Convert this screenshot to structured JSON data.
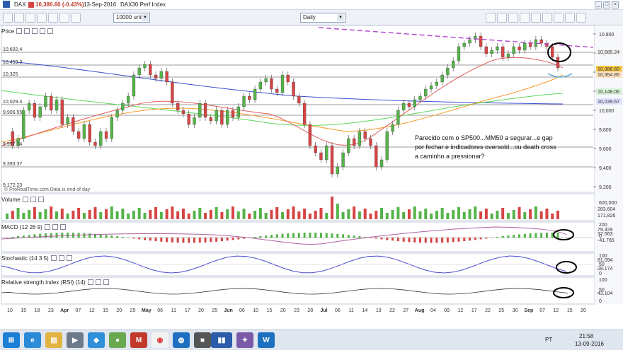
{
  "titlebar": {
    "symbol": "DAX",
    "price": "10,386.60 (-0.43%)",
    "date": "13-Sep-2016",
    "instrument": "DAX30 Perf Index"
  },
  "toolbar": {
    "units": "10000 units",
    "period": "Daily"
  },
  "panels": {
    "price": "Price",
    "volume": "Volume",
    "macd": "MACD (12 26 9)",
    "stochastic": "Stochastic (14 3 5)",
    "rsi": "Relative strength index (RSI) (14)"
  },
  "annotation": {
    "line1": "Parecido com o SP500...MM50 a segurar...e gap",
    "line2": "por fechar e indicadores oversold...ou death cross",
    "line3": "a caminho a pressionar?"
  },
  "watermark": "© ProRealTime.com  Data is end of day",
  "price_axis": [
    "10,800",
    "10,600",
    "10,400",
    "10,200",
    "10,000",
    "9,800",
    "9,600",
    "9,400",
    "9,200"
  ],
  "level_labels": [
    "10,602.4",
    "10,459.3",
    "10,325",
    "10,029.4",
    "9,906.55",
    "9,597.14",
    "9,393.37",
    "9,172.23"
  ],
  "right_labels": {
    "p1": "10,585.24",
    "p2": "10,386.60",
    "p3": "10,354.85",
    "p4": "10,148.06",
    "p5": "10,039.67"
  },
  "volume_labels": [
    "283,604",
    "171,826"
  ],
  "volume_axis": "600,000",
  "macd_labels": [
    "79.329",
    "37.563",
    "-41.765"
  ],
  "macd_axis": [
    "200",
    "0"
  ],
  "stoch_labels": [
    "81.094",
    "28.174"
  ],
  "stoch_axis": [
    "100",
    "50",
    "0"
  ],
  "rsi_labels": [
    "43.104"
  ],
  "rsi_axis": [
    "100",
    "50",
    "0"
  ],
  "date_axis": [
    "10",
    "15",
    "18",
    "23",
    "Apr",
    "07",
    "12",
    "15",
    "20",
    "25",
    "May",
    "06",
    "11",
    "17",
    "20",
    "25",
    "Jun",
    "06",
    "10",
    "15",
    "20",
    "23",
    "28",
    "Jul",
    "06",
    "11",
    "14",
    "19",
    "22",
    "27",
    "Aug",
    "04",
    "09",
    "12",
    "17",
    "22",
    "25",
    "30",
    "Sep",
    "07",
    "12",
    "15",
    "20"
  ],
  "taskbar": {
    "lang": "PT",
    "time": "21:58",
    "date": "13-09-2016"
  },
  "colors": {
    "up": "#55b34a",
    "down": "#d64545",
    "ma_blue": "#3a4fd0",
    "ma_green": "#5cd65c",
    "ma_orange": "#f59a2a",
    "ma_red": "#e06060",
    "trend": "#b44fd0"
  }
}
